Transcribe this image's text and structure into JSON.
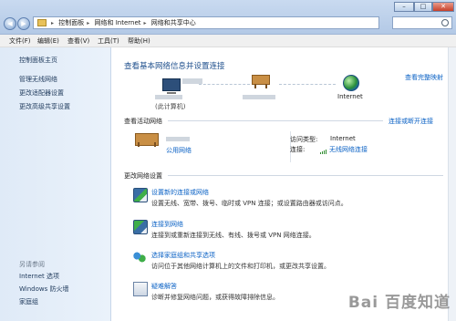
{
  "window": {
    "breadcrumb": [
      "控制面板",
      "网络和 Internet",
      "网络和共享中心"
    ],
    "controls": {
      "min": "–",
      "max": "□",
      "close": "✕"
    }
  },
  "menu": [
    "文件(F)",
    "编辑(E)",
    "查看(V)",
    "工具(T)",
    "帮助(H)"
  ],
  "sidebar": {
    "items": [
      "控制面板主页",
      "管理无线网络",
      "更改适配器设置",
      "更改高级共享设置"
    ],
    "see_also_title": "另请参阅",
    "see_also": [
      "Internet 选项",
      "Windows 防火墙",
      "家庭组"
    ]
  },
  "main": {
    "title": "查看基本网络信息并设置连接",
    "full_map": "查看完整映射",
    "computer_caption": "(此计算机)",
    "internet_label": "Internet",
    "active_title": "查看活动网络",
    "connect_disconnect": "连接或断开连接",
    "network_type_link": "公用网络",
    "access_type_label": "访问类型:",
    "access_type_value": "Internet",
    "connections_label": "连接:",
    "connection_value": "无线网络连接",
    "change_title": "更改网络设置",
    "tasks": [
      {
        "title": "设置新的连接或网络",
        "desc": "设置无线、宽带、拨号、临时或 VPN 连接；或设置路由器或访问点。",
        "icon": "network-setup-icon"
      },
      {
        "title": "连接到网络",
        "desc": "连接到或重新连接到无线、有线、拨号或 VPN 网络连接。",
        "icon": "connect-network-icon"
      },
      {
        "title": "选择家庭组和共享选项",
        "desc": "访问位于其他网络计算机上的文件和打印机，或更改共享设置。",
        "icon": "homegroup-icon"
      },
      {
        "title": "疑难解答",
        "desc": "诊断并修复网络问题，或获得故障排除信息。",
        "icon": "troubleshoot-icon"
      }
    ]
  },
  "watermark": {
    "text": "Bai  百度知道"
  },
  "colors": {
    "link": "#0b62c5",
    "title": "#1e4f8c"
  }
}
